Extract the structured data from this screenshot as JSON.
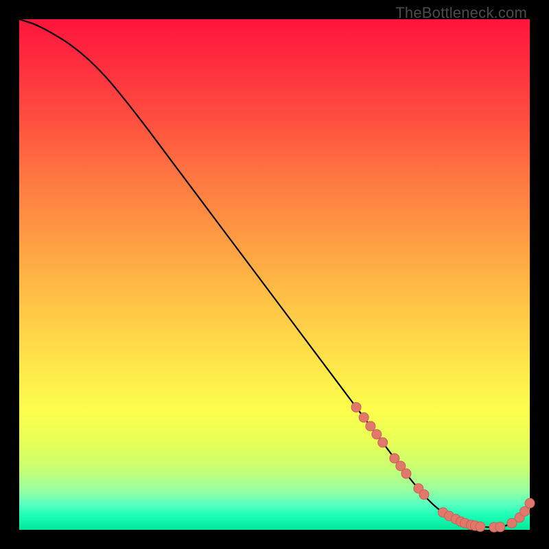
{
  "watermark": "TheBottleneck.com",
  "colors": {
    "background": "#000000",
    "curve": "#000000",
    "marker_fill": "#e0786b",
    "marker_stroke": "#c76156",
    "gradient_top": "#ff153c",
    "gradient_bottom": "#00e89a"
  },
  "chart_data": {
    "type": "line",
    "title": "",
    "xlabel": "",
    "ylabel": "",
    "xlim": [
      0,
      100
    ],
    "ylim": [
      0,
      100
    ],
    "grid": false,
    "legend": false,
    "series": [
      {
        "name": "bottleneck-curve",
        "x": [
          0,
          3,
          6,
          10,
          14,
          18,
          24,
          30,
          36,
          42,
          48,
          54,
          60,
          66,
          72,
          76,
          80,
          83,
          86,
          89,
          92,
          95,
          98,
          100
        ],
        "y": [
          100,
          99,
          97.5,
          95,
          91.7,
          87.5,
          80,
          72,
          64,
          56,
          48,
          40,
          32,
          24,
          16,
          10.7,
          6,
          3.4,
          1.8,
          0.9,
          0.5,
          0.7,
          2.4,
          5.2
        ]
      }
    ],
    "markers": [
      {
        "x": 66.0,
        "y": 24.0
      },
      {
        "x": 67.5,
        "y": 22.0
      },
      {
        "x": 68.8,
        "y": 20.3
      },
      {
        "x": 70.0,
        "y": 18.7
      },
      {
        "x": 71.2,
        "y": 17.1
      },
      {
        "x": 73.5,
        "y": 14.0
      },
      {
        "x": 74.7,
        "y": 12.5
      },
      {
        "x": 75.8,
        "y": 11.0
      },
      {
        "x": 78.2,
        "y": 8.1
      },
      {
        "x": 79.3,
        "y": 6.9
      },
      {
        "x": 83.0,
        "y": 3.4
      },
      {
        "x": 84.2,
        "y": 2.7
      },
      {
        "x": 85.5,
        "y": 2.1
      },
      {
        "x": 86.5,
        "y": 1.6
      },
      {
        "x": 87.3,
        "y": 1.3
      },
      {
        "x": 88.5,
        "y": 0.95
      },
      {
        "x": 89.3,
        "y": 0.8
      },
      {
        "x": 90.3,
        "y": 0.6
      },
      {
        "x": 93.0,
        "y": 0.5
      },
      {
        "x": 94.2,
        "y": 0.55
      },
      {
        "x": 96.5,
        "y": 1.3
      },
      {
        "x": 98.0,
        "y": 2.4
      },
      {
        "x": 99.0,
        "y": 3.6
      },
      {
        "x": 100.0,
        "y": 5.2
      }
    ]
  }
}
